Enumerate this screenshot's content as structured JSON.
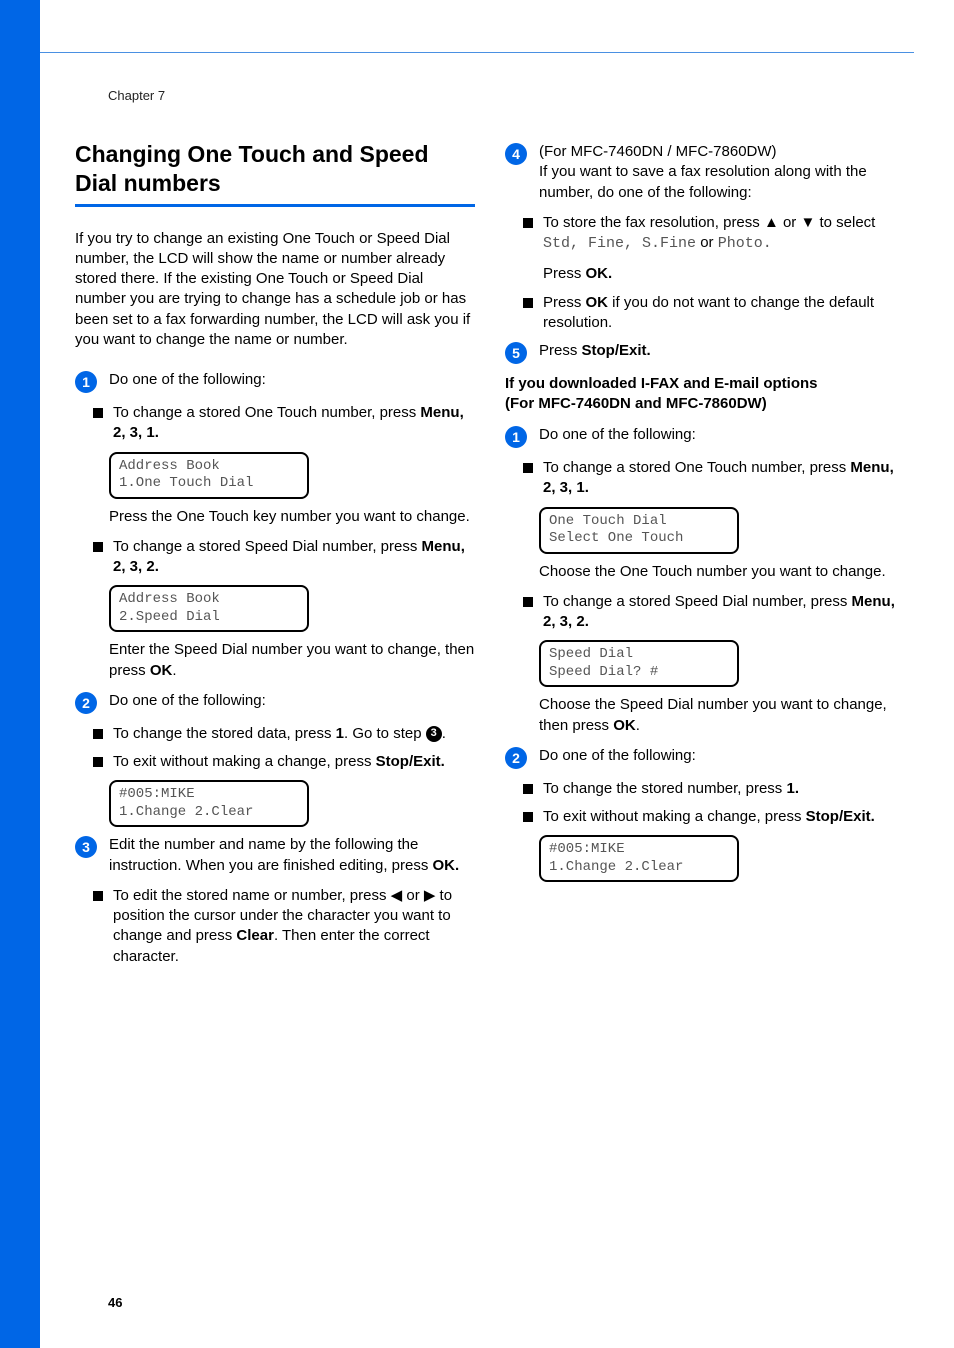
{
  "header": {
    "chapter": "Chapter 7",
    "page_num": "46"
  },
  "section_title": "Changing One Touch and Speed Dial numbers",
  "intro": "If you try to change an existing One Touch or Speed Dial number, the LCD will show the name or number already stored there. If the existing One Touch or Speed Dial number you are trying to change has a schedule job or has been set to a fax forwarding number, the LCD will ask you if you want to change the name or number.",
  "left": {
    "step1": {
      "text": "Do one of the following:",
      "bullet1a": "To change a stored One Touch number, press ",
      "bullet1a_keys": "Menu, 2, 3, 1.",
      "lcd1_l1": "Address Book",
      "lcd1_l2": "1.One Touch Dial",
      "after1a": "Press the One Touch key number you want to change.",
      "bullet1b": "To change a stored Speed Dial number, press ",
      "bullet1b_keys": "Menu, 2, 3, 2.",
      "lcd2_l1": "Address Book",
      "lcd2_l2": "2.Speed Dial",
      "after1b": "Enter the Speed Dial number you want to change, then press "
    },
    "step2": {
      "text": "Do one of the following:",
      "bullet2a_pre": "To change the stored data, press ",
      "bullet2a_key": "1",
      "bullet2a_post1": ". Go to step ",
      "bullet2b": "To exit without making a change, press ",
      "bullet2b_key": "Stop/Exit.",
      "lcd3_l1": "#005:MIKE",
      "lcd3_l2": "1.Change 2.Clear"
    },
    "step3": {
      "text": "Edit the number and name by the following the instruction. When you are finished editing, press ",
      "text_key": "OK.",
      "bullet3a": "To edit the stored name or number, press ◀ or ▶ to position the cursor under the character you want to change and press ",
      "bullet3a_key": "Clear",
      "bullet3a_post": ". Then enter the correct character."
    }
  },
  "right": {
    "step4": {
      "prefix": "(For MFC-7460DN / MFC-7860DW)",
      "text": "If you want to save a fax resolution along with the number, do one of the following:",
      "bullet4a_pre": "To store the fax resolution, press ▲ or ▼ to select ",
      "bullet4a_mono": "Std, Fine, S.Fine",
      "bullet4a_mid": " or ",
      "bullet4a_mono2": "Photo.",
      "bullet4a_press": "Press ",
      "bullet4a_ok": "OK.",
      "bullet4b_pre": "Press ",
      "bullet4b_ok": "OK",
      "bullet4b_post": " if you do not want to change the default resolution."
    },
    "step5": {
      "pre": "Press ",
      "key": "Stop/Exit."
    },
    "subheading_l1": "If you downloaded I-FAX and E-mail options",
    "subheading_l2": "(For MFC-7460DN and MFC-7860DW)",
    "r_step1": {
      "text": "Do one of the following:",
      "bullet1a": "To change a stored One Touch number, press ",
      "bullet1a_keys": "Menu, 2, 3, 1.",
      "lcd1_l1": "One Touch Dial",
      "lcd1_l2": "Select One Touch",
      "after1a": "Choose the One Touch number you want to change.",
      "bullet1b": "To change a stored Speed Dial number, press ",
      "bullet1b_keys": "Menu, 2, 3, 2.",
      "lcd2_l1": "Speed Dial",
      "lcd2_l2": "Speed Dial? #",
      "after1b": "Choose the Speed Dial number you want to change, then press "
    },
    "r_step2": {
      "text": "Do one of the following:",
      "bullet2a_pre": "To change the stored number, press ",
      "bullet2a_key": "1.",
      "bullet2b": "To exit without making a change, press ",
      "bullet2b_key": "Stop/Exit.",
      "lcd3_l1": "#005:MIKE",
      "lcd3_l2": "1.Change 2.Clear"
    }
  }
}
